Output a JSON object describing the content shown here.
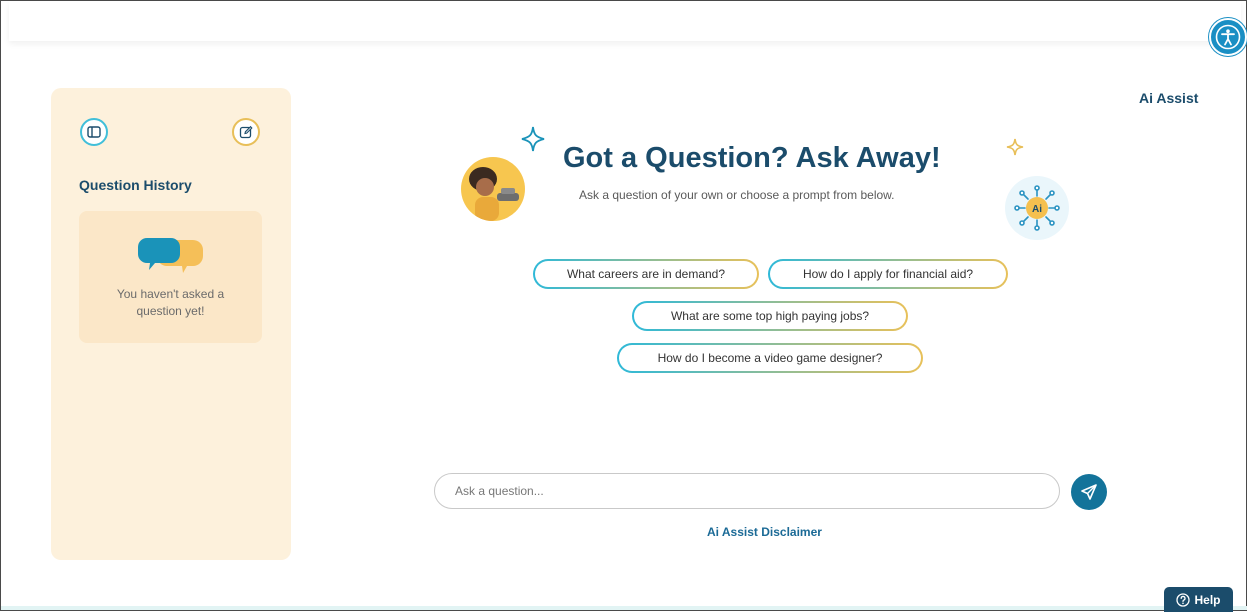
{
  "header": {
    "accessibility_icon": "accessibility-icon",
    "page_label": "Ai Assist"
  },
  "sidebar": {
    "title": "Question History",
    "toggle_icon": "sidebar-toggle-icon",
    "new_chat_icon": "edit-icon",
    "empty_state": {
      "icon": "chat-bubbles-icon",
      "text_line1": "You haven't asked a",
      "text_line2": "question yet!"
    }
  },
  "hero": {
    "title": "Got a Question? Ask Away!",
    "subtitle": "Ask a question of your own or choose a prompt from below.",
    "badge_label": "Ai"
  },
  "prompts": [
    "What careers are in demand?",
    "How do I apply for financial aid?",
    "What are some top high paying jobs?",
    "How do I become a video game designer?"
  ],
  "composer": {
    "placeholder": "Ask a question...",
    "send_icon": "send-icon",
    "disclaimer": "Ai Assist Disclaimer"
  },
  "help": {
    "label": "Help",
    "icon": "help-circle-icon"
  },
  "colors": {
    "primary": "#1b4c6b",
    "accent_teal": "#2fb9d8",
    "accent_gold": "#e8c15a",
    "sidebar_bg": "#fdf1dc"
  }
}
